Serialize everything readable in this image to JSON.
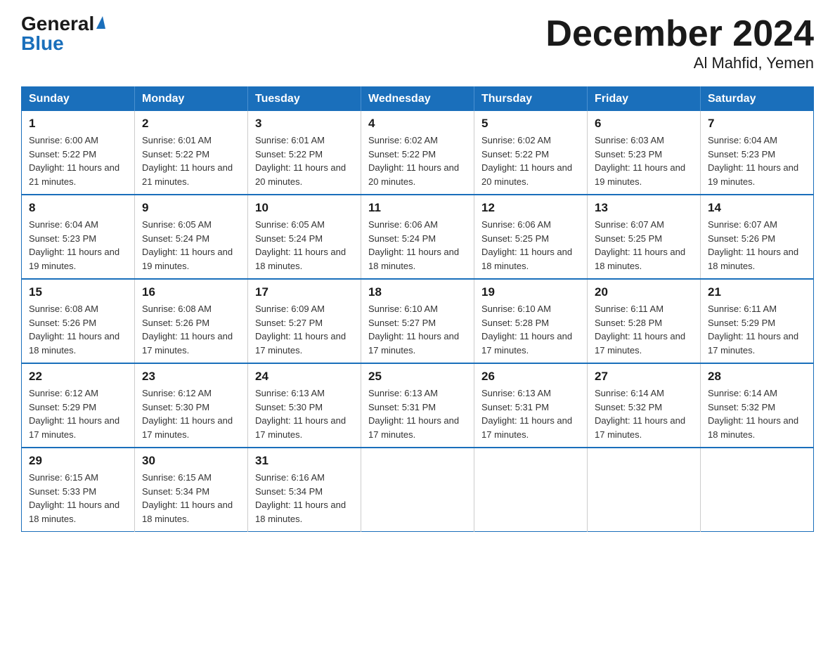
{
  "logo": {
    "general": "General",
    "blue": "Blue"
  },
  "title": "December 2024",
  "subtitle": "Al Mahfid, Yemen",
  "days_of_week": [
    "Sunday",
    "Monday",
    "Tuesday",
    "Wednesday",
    "Thursday",
    "Friday",
    "Saturday"
  ],
  "weeks": [
    [
      {
        "day": "1",
        "sunrise": "Sunrise: 6:00 AM",
        "sunset": "Sunset: 5:22 PM",
        "daylight": "Daylight: 11 hours and 21 minutes."
      },
      {
        "day": "2",
        "sunrise": "Sunrise: 6:01 AM",
        "sunset": "Sunset: 5:22 PM",
        "daylight": "Daylight: 11 hours and 21 minutes."
      },
      {
        "day": "3",
        "sunrise": "Sunrise: 6:01 AM",
        "sunset": "Sunset: 5:22 PM",
        "daylight": "Daylight: 11 hours and 20 minutes."
      },
      {
        "day": "4",
        "sunrise": "Sunrise: 6:02 AM",
        "sunset": "Sunset: 5:22 PM",
        "daylight": "Daylight: 11 hours and 20 minutes."
      },
      {
        "day": "5",
        "sunrise": "Sunrise: 6:02 AM",
        "sunset": "Sunset: 5:22 PM",
        "daylight": "Daylight: 11 hours and 20 minutes."
      },
      {
        "day": "6",
        "sunrise": "Sunrise: 6:03 AM",
        "sunset": "Sunset: 5:23 PM",
        "daylight": "Daylight: 11 hours and 19 minutes."
      },
      {
        "day": "7",
        "sunrise": "Sunrise: 6:04 AM",
        "sunset": "Sunset: 5:23 PM",
        "daylight": "Daylight: 11 hours and 19 minutes."
      }
    ],
    [
      {
        "day": "8",
        "sunrise": "Sunrise: 6:04 AM",
        "sunset": "Sunset: 5:23 PM",
        "daylight": "Daylight: 11 hours and 19 minutes."
      },
      {
        "day": "9",
        "sunrise": "Sunrise: 6:05 AM",
        "sunset": "Sunset: 5:24 PM",
        "daylight": "Daylight: 11 hours and 19 minutes."
      },
      {
        "day": "10",
        "sunrise": "Sunrise: 6:05 AM",
        "sunset": "Sunset: 5:24 PM",
        "daylight": "Daylight: 11 hours and 18 minutes."
      },
      {
        "day": "11",
        "sunrise": "Sunrise: 6:06 AM",
        "sunset": "Sunset: 5:24 PM",
        "daylight": "Daylight: 11 hours and 18 minutes."
      },
      {
        "day": "12",
        "sunrise": "Sunrise: 6:06 AM",
        "sunset": "Sunset: 5:25 PM",
        "daylight": "Daylight: 11 hours and 18 minutes."
      },
      {
        "day": "13",
        "sunrise": "Sunrise: 6:07 AM",
        "sunset": "Sunset: 5:25 PM",
        "daylight": "Daylight: 11 hours and 18 minutes."
      },
      {
        "day": "14",
        "sunrise": "Sunrise: 6:07 AM",
        "sunset": "Sunset: 5:26 PM",
        "daylight": "Daylight: 11 hours and 18 minutes."
      }
    ],
    [
      {
        "day": "15",
        "sunrise": "Sunrise: 6:08 AM",
        "sunset": "Sunset: 5:26 PM",
        "daylight": "Daylight: 11 hours and 18 minutes."
      },
      {
        "day": "16",
        "sunrise": "Sunrise: 6:08 AM",
        "sunset": "Sunset: 5:26 PM",
        "daylight": "Daylight: 11 hours and 17 minutes."
      },
      {
        "day": "17",
        "sunrise": "Sunrise: 6:09 AM",
        "sunset": "Sunset: 5:27 PM",
        "daylight": "Daylight: 11 hours and 17 minutes."
      },
      {
        "day": "18",
        "sunrise": "Sunrise: 6:10 AM",
        "sunset": "Sunset: 5:27 PM",
        "daylight": "Daylight: 11 hours and 17 minutes."
      },
      {
        "day": "19",
        "sunrise": "Sunrise: 6:10 AM",
        "sunset": "Sunset: 5:28 PM",
        "daylight": "Daylight: 11 hours and 17 minutes."
      },
      {
        "day": "20",
        "sunrise": "Sunrise: 6:11 AM",
        "sunset": "Sunset: 5:28 PM",
        "daylight": "Daylight: 11 hours and 17 minutes."
      },
      {
        "day": "21",
        "sunrise": "Sunrise: 6:11 AM",
        "sunset": "Sunset: 5:29 PM",
        "daylight": "Daylight: 11 hours and 17 minutes."
      }
    ],
    [
      {
        "day": "22",
        "sunrise": "Sunrise: 6:12 AM",
        "sunset": "Sunset: 5:29 PM",
        "daylight": "Daylight: 11 hours and 17 minutes."
      },
      {
        "day": "23",
        "sunrise": "Sunrise: 6:12 AM",
        "sunset": "Sunset: 5:30 PM",
        "daylight": "Daylight: 11 hours and 17 minutes."
      },
      {
        "day": "24",
        "sunrise": "Sunrise: 6:13 AM",
        "sunset": "Sunset: 5:30 PM",
        "daylight": "Daylight: 11 hours and 17 minutes."
      },
      {
        "day": "25",
        "sunrise": "Sunrise: 6:13 AM",
        "sunset": "Sunset: 5:31 PM",
        "daylight": "Daylight: 11 hours and 17 minutes."
      },
      {
        "day": "26",
        "sunrise": "Sunrise: 6:13 AM",
        "sunset": "Sunset: 5:31 PM",
        "daylight": "Daylight: 11 hours and 17 minutes."
      },
      {
        "day": "27",
        "sunrise": "Sunrise: 6:14 AM",
        "sunset": "Sunset: 5:32 PM",
        "daylight": "Daylight: 11 hours and 17 minutes."
      },
      {
        "day": "28",
        "sunrise": "Sunrise: 6:14 AM",
        "sunset": "Sunset: 5:32 PM",
        "daylight": "Daylight: 11 hours and 18 minutes."
      }
    ],
    [
      {
        "day": "29",
        "sunrise": "Sunrise: 6:15 AM",
        "sunset": "Sunset: 5:33 PM",
        "daylight": "Daylight: 11 hours and 18 minutes."
      },
      {
        "day": "30",
        "sunrise": "Sunrise: 6:15 AM",
        "sunset": "Sunset: 5:34 PM",
        "daylight": "Daylight: 11 hours and 18 minutes."
      },
      {
        "day": "31",
        "sunrise": "Sunrise: 6:16 AM",
        "sunset": "Sunset: 5:34 PM",
        "daylight": "Daylight: 11 hours and 18 minutes."
      },
      null,
      null,
      null,
      null
    ]
  ]
}
